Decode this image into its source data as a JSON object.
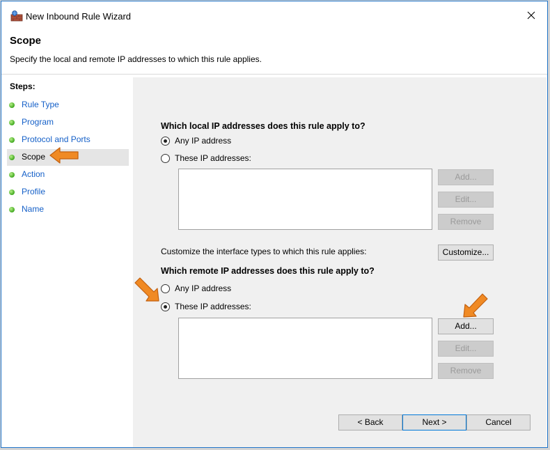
{
  "window": {
    "title": "New Inbound Rule Wizard"
  },
  "header": {
    "title": "Scope",
    "subtitle": "Specify the local and remote IP addresses to which this rule applies."
  },
  "sidebar": {
    "heading": "Steps:",
    "items": [
      {
        "label": "Rule Type",
        "selected": false
      },
      {
        "label": "Program",
        "selected": false
      },
      {
        "label": "Protocol and Ports",
        "selected": false
      },
      {
        "label": "Scope",
        "selected": true
      },
      {
        "label": "Action",
        "selected": false
      },
      {
        "label": "Profile",
        "selected": false
      },
      {
        "label": "Name",
        "selected": false
      }
    ]
  },
  "local": {
    "question": "Which local IP addresses does this rule apply to?",
    "option_any": "Any IP address",
    "option_these": "These IP addresses:",
    "selected": "any",
    "add": "Add...",
    "edit": "Edit...",
    "remove": "Remove"
  },
  "customize": {
    "label": "Customize the interface types to which this rule applies:",
    "button": "Customize..."
  },
  "remote": {
    "question": "Which remote IP addresses does this rule apply to?",
    "option_any": "Any IP address",
    "option_these": "These IP addresses:",
    "selected": "these",
    "add": "Add...",
    "edit": "Edit...",
    "remove": "Remove"
  },
  "footer": {
    "back": "< Back",
    "next": "Next >",
    "cancel": "Cancel"
  },
  "colors": {
    "link": "#1560c8",
    "arrow": "#f08a24",
    "content_bg": "#f0f0f0",
    "border": "#1e73c8"
  },
  "icons": {
    "app": "firewall-icon",
    "close": "close-icon",
    "step": "green-dot-icon",
    "annotation": "orange-arrow-icon"
  }
}
